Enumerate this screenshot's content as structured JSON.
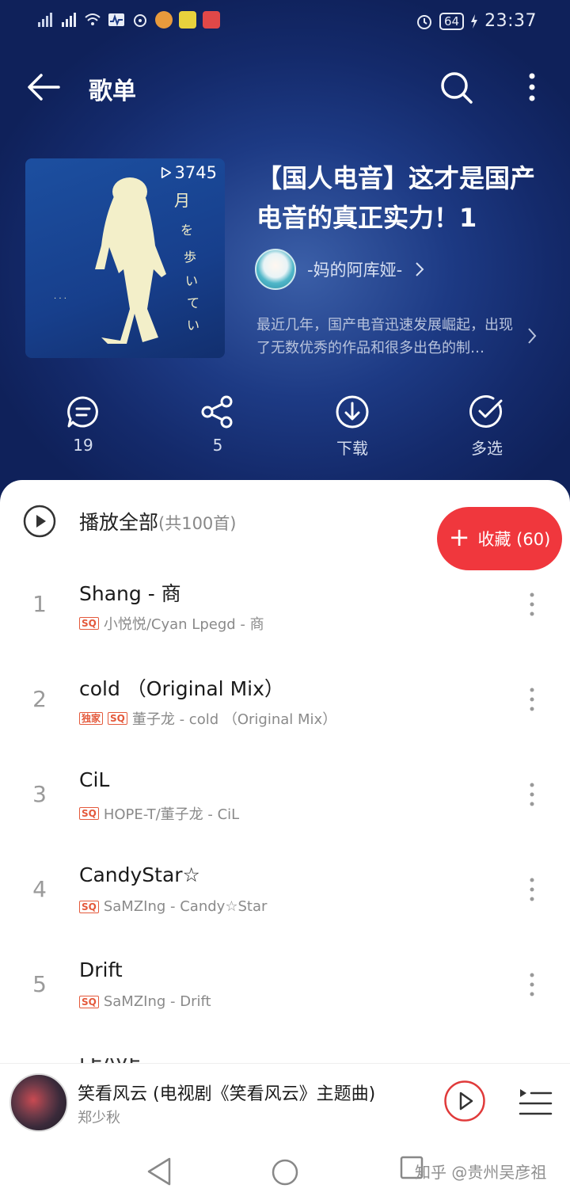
{
  "status_bar": {
    "battery": "64",
    "time": "23:37"
  },
  "header": {
    "title": "歌单"
  },
  "playlist": {
    "play_count": "3745",
    "title": "【国人电音】这才是国产电音的真正实力！1",
    "creator": "-妈的阿库娅-",
    "description": "最近几年，国产电音迅速发展崛起，出现了无数优秀的作品和很多出色的制…"
  },
  "actions": [
    {
      "icon": "comment-icon",
      "label": "19"
    },
    {
      "icon": "share-icon",
      "label": "5"
    },
    {
      "icon": "download-icon",
      "label": "下载"
    },
    {
      "icon": "multi-select-icon",
      "label": "多选"
    }
  ],
  "list": {
    "play_all_label": "播放全部",
    "play_all_count": "(共100首)",
    "collect_label": "收藏 (60)",
    "songs": [
      {
        "num": "1",
        "title": "Shang - 商",
        "tags": [
          "SQ"
        ],
        "subtitle": "小悦悦/Cyan Lpegd - 商"
      },
      {
        "num": "2",
        "title": "cold （Original Mix）",
        "tags": [
          "独家",
          "SQ"
        ],
        "subtitle": "董子龙 - cold （Original Mix）"
      },
      {
        "num": "3",
        "title": "CiL",
        "tags": [
          "SQ"
        ],
        "subtitle": "HOPE-T/董子龙 - CiL"
      },
      {
        "num": "4",
        "title": "CandyStar☆",
        "tags": [
          "SQ"
        ],
        "subtitle": "SaMZIng - Candy☆Star"
      },
      {
        "num": "5",
        "title": "Drift",
        "tags": [
          "SQ"
        ],
        "subtitle": "SaMZIng - Drift"
      }
    ],
    "cutoff_title": "LEAVE"
  },
  "mini_player": {
    "title": "笑看风云 (电视剧《笑看风云》主题曲)",
    "artist": "郑少秋"
  },
  "watermark": "知乎 @贵州吴彦祖",
  "colors": {
    "accent_red": "#f0373d",
    "hero_blue": "#1d3a84"
  }
}
